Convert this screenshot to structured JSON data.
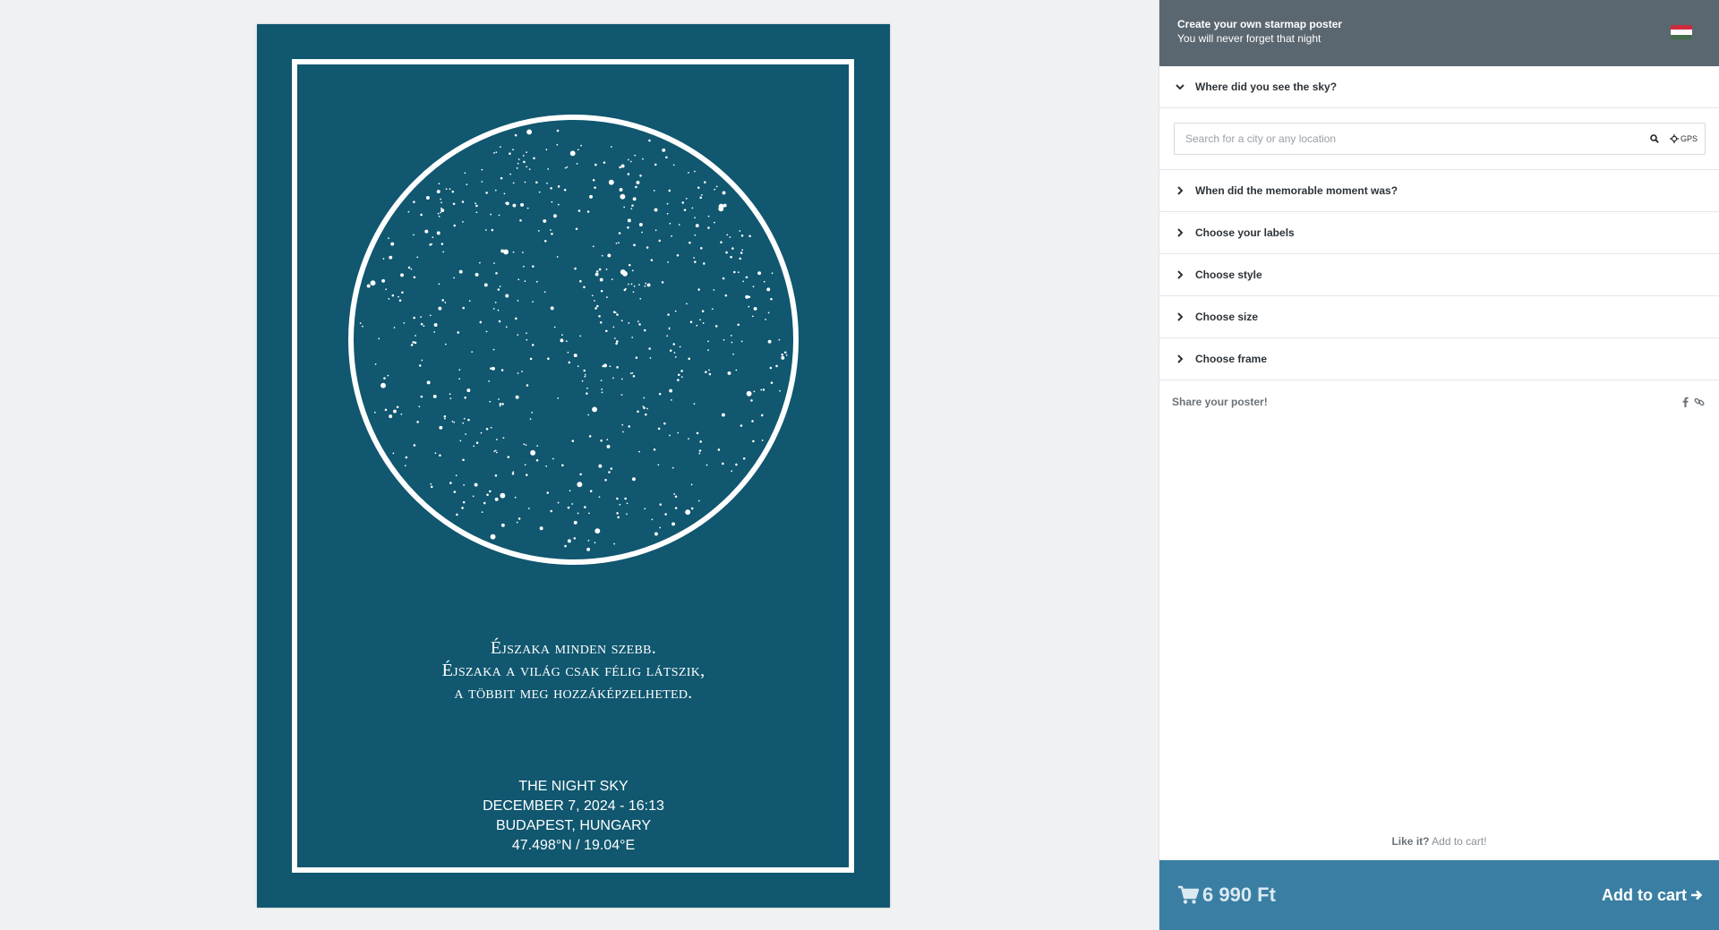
{
  "poster": {
    "quote_lines": [
      "Éjszaka minden szebb.",
      "Éjszaka a világ csak félig látszik,",
      "a többit meg hozzáképzelheted."
    ],
    "title": "THE NIGHT SKY",
    "date": "DECEMBER 7, 2024 - 16:13",
    "place": "BUDAPEST, HUNGARY",
    "coords": "47.498°N / 19.04°E",
    "bg_color": "#10576f",
    "star_color": "#ffffff"
  },
  "panel": {
    "header": {
      "title": "Create your own starmap poster",
      "subtitle": "You will never forget that night",
      "flag_icon": "hungary-flag-icon",
      "flag_colors": [
        "#cd2a3e",
        "#ffffff",
        "#436f4d"
      ]
    },
    "sections": {
      "location": "Where did you see the sky?",
      "moment": "When did the memorable moment was?",
      "labels": "Choose your labels",
      "style": "Choose style",
      "size": "Choose size",
      "frame": "Choose frame"
    },
    "search": {
      "placeholder": "Search for a city or any location",
      "value": "",
      "gps_label": "GPS"
    },
    "share": {
      "label": "Share your poster!",
      "icons": [
        "facebook-icon",
        "link-icon"
      ]
    },
    "like": {
      "bold": "Like it?",
      "rest": "Add to cart!"
    },
    "cart": {
      "price": "6 990 Ft",
      "button": "Add to cart",
      "accent": "#3a7fa3"
    }
  }
}
